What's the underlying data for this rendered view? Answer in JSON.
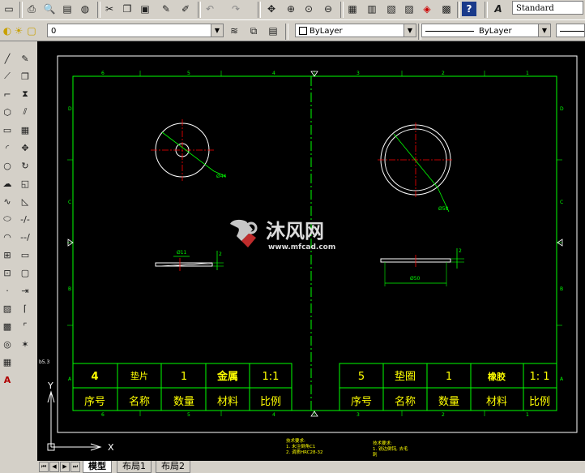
{
  "toolbar": {
    "text_style": "Standard",
    "layer_value": "0",
    "color_value": "ByLayer",
    "linetype_value": "ByLayer"
  },
  "watermark": {
    "title": "沐风网",
    "url": "www.mfcad.com"
  },
  "drawing": {
    "frame_top_numbers": [
      "6",
      "5",
      "4",
      "3",
      "2",
      "1"
    ],
    "frame_bottom_numbers": [
      "6",
      "5",
      "4",
      "3",
      "2",
      "1"
    ],
    "frame_left_letters": [
      "D",
      "C",
      "B",
      "A"
    ],
    "frame_right_letters": [
      "D",
      "C",
      "B",
      "A"
    ],
    "left_part": {
      "diameter_label": "Ø44",
      "thickness_label": "2",
      "hole_label": "Ø11"
    },
    "right_part": {
      "diameter_label": "Ø58",
      "width_label": "Ø50",
      "thickness_label": "2"
    },
    "left_titleblock": {
      "values": [
        "4",
        "垫片",
        "1",
        "金属",
        "1:1"
      ],
      "headers": [
        "序号",
        "名称",
        "数量",
        "材料",
        "比例"
      ]
    },
    "right_titleblock": {
      "values": [
        "5",
        "垫圈",
        "1",
        "橡胶",
        "1: 1"
      ],
      "headers": [
        "序号",
        "名称",
        "数量",
        "材料",
        "比例"
      ]
    },
    "notes_left": [
      "技术要求:",
      "1. 未注倒角C1",
      "2. 调质HRC28-32"
    ],
    "notes_right": [
      "技术要求:",
      "1. 锐边倒钝, 去毛",
      "刺"
    ],
    "side_label": "b5.3",
    "ucs_x": "X",
    "ucs_y": "Y"
  },
  "tabs": [
    "模型",
    "布局1",
    "布局2"
  ],
  "colors": {
    "canvas": "#000000",
    "frame": "#00ff00",
    "centerline": "#ff0000",
    "geometry": "#ffffff",
    "dimension": "#00ff00",
    "text_yellow": "#ffff00"
  }
}
